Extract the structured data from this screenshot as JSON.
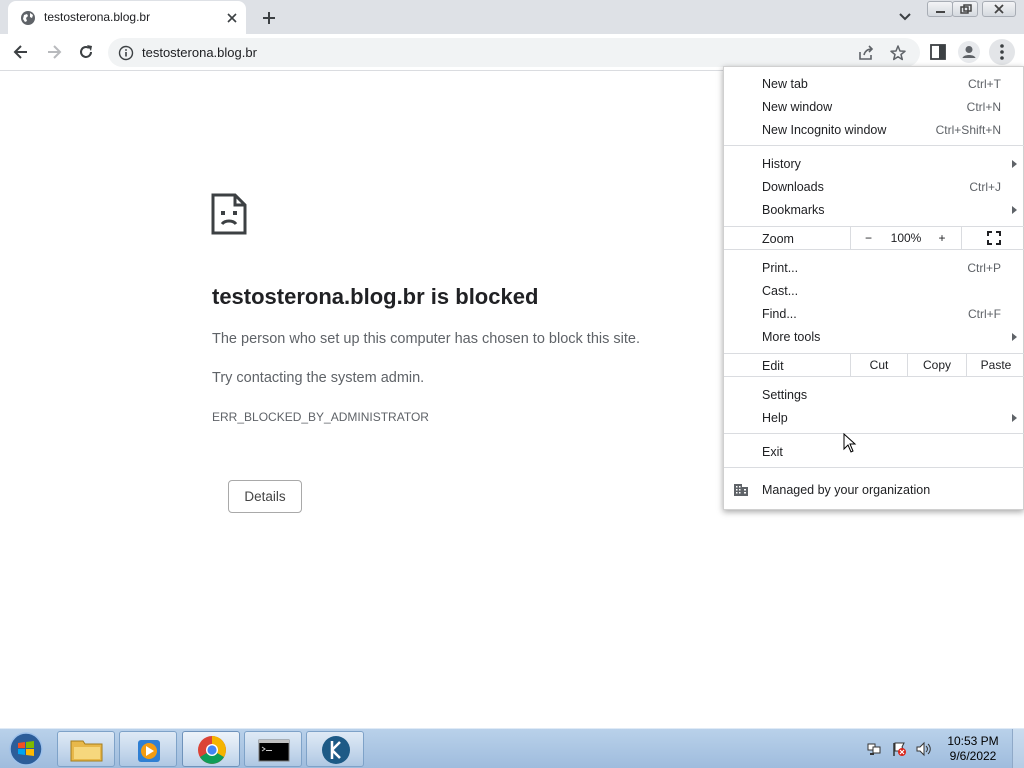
{
  "tab": {
    "title": "testosterona.blog.br",
    "favicon": "globe-icon"
  },
  "toolbar": {
    "url": "testosterona.blog.br"
  },
  "page": {
    "title": "testosterona.blog.br is blocked",
    "message": "The person who set up this computer has chosen to block this site.",
    "hint": "Try contacting the system admin.",
    "error_code": "ERR_BLOCKED_BY_ADMINISTRATOR",
    "details_label": "Details"
  },
  "menu": {
    "new_tab": {
      "label": "New tab",
      "shortcut": "Ctrl+T"
    },
    "new_window": {
      "label": "New window",
      "shortcut": "Ctrl+N"
    },
    "new_incognito": {
      "label": "New Incognito window",
      "shortcut": "Ctrl+Shift+N"
    },
    "history": {
      "label": "History"
    },
    "downloads": {
      "label": "Downloads",
      "shortcut": "Ctrl+J"
    },
    "bookmarks": {
      "label": "Bookmarks"
    },
    "zoom": {
      "label": "Zoom",
      "minus": "−",
      "level": "100%",
      "plus": "+"
    },
    "print": {
      "label": "Print...",
      "shortcut": "Ctrl+P"
    },
    "cast": {
      "label": "Cast..."
    },
    "find": {
      "label": "Find...",
      "shortcut": "Ctrl+F"
    },
    "more_tools": {
      "label": "More tools"
    },
    "edit": {
      "label": "Edit",
      "cut": "Cut",
      "copy": "Copy",
      "paste": "Paste"
    },
    "settings": {
      "label": "Settings"
    },
    "help": {
      "label": "Help"
    },
    "exit": {
      "label": "Exit"
    },
    "managed": {
      "label": "Managed by your organization"
    }
  },
  "taskbar": {
    "apps": [
      "file-explorer",
      "media-player",
      "chrome",
      "command-prompt",
      "custom-app"
    ],
    "clock": {
      "time": "10:53 PM",
      "date": "9/6/2022"
    }
  }
}
